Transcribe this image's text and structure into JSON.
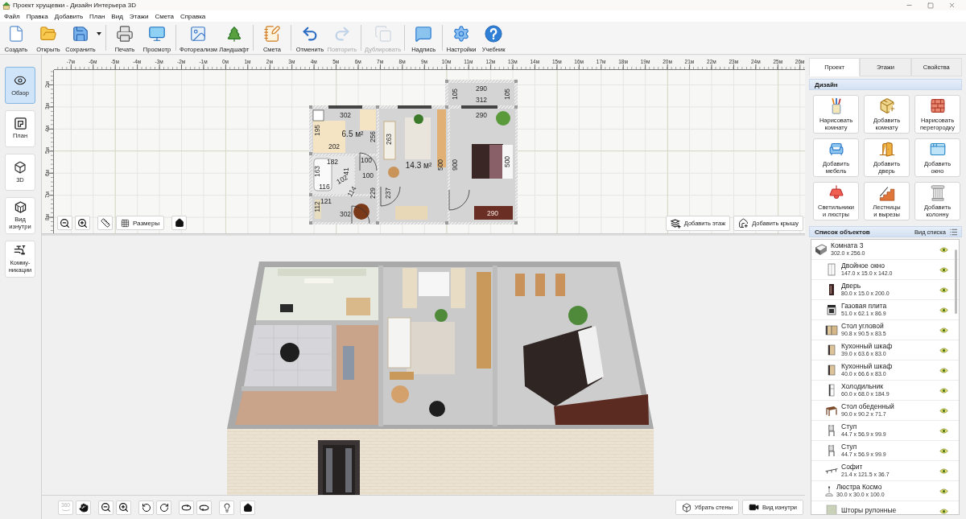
{
  "window": {
    "title": "Проект хрущевки - Дизайн Интерьера 3D"
  },
  "menu": [
    "Файл",
    "Правка",
    "Добавить",
    "План",
    "Вид",
    "Этажи",
    "Смета",
    "Справка"
  ],
  "toolbar": {
    "groups": [
      [
        {
          "label": "Создать",
          "disabled": false,
          "dropdown": false
        },
        {
          "label": "Открыть",
          "disabled": false,
          "dropdown": false
        },
        {
          "label": "Сохранить",
          "disabled": false,
          "dropdown": true
        }
      ],
      [
        {
          "label": "Печать",
          "disabled": false,
          "dropdown": false
        },
        {
          "label": "Просмотр",
          "disabled": false,
          "dropdown": false
        }
      ],
      [
        {
          "label": "Фотореализм",
          "disabled": false,
          "dropdown": false
        },
        {
          "label": "Ландшафт",
          "disabled": false,
          "dropdown": false
        }
      ],
      [
        {
          "label": "Смета",
          "disabled": false,
          "dropdown": false
        }
      ],
      [
        {
          "label": "Отменить",
          "disabled": false,
          "dropdown": false
        },
        {
          "label": "Повторить",
          "disabled": true,
          "dropdown": false
        }
      ],
      [
        {
          "label": "Дублировать",
          "disabled": true,
          "dropdown": false
        }
      ],
      [
        {
          "label": "Надпись",
          "disabled": false,
          "dropdown": false
        }
      ],
      [
        {
          "label": "Настройки",
          "disabled": false,
          "dropdown": false
        },
        {
          "label": "Учебник",
          "disabled": false,
          "dropdown": false
        }
      ]
    ]
  },
  "sidebar": {
    "items": [
      {
        "label": "Обзор",
        "selected": true
      },
      {
        "label": "План",
        "selected": false
      },
      {
        "label": "3D",
        "selected": false
      },
      {
        "label": "Вид изнутри",
        "selected": false
      },
      {
        "label": "Комму-никации",
        "selected": false
      }
    ]
  },
  "plan": {
    "ruler_x": [
      "-7м",
      "-6м",
      "-5м",
      "-4м",
      "-3м",
      "-2м",
      "-1м",
      "0м",
      "1м",
      "2м",
      "3м",
      "4м",
      "5м",
      "6м",
      "7м",
      "8м",
      "9м",
      "10м",
      "11м",
      "12м",
      "13м",
      "14м",
      "15м",
      "16м",
      "17м",
      "18м",
      "19м",
      "20м",
      "21м",
      "22м",
      "23м",
      "24м",
      "25м",
      "26м"
    ],
    "ruler_y": [
      "2м",
      "3м",
      "4м",
      "5м",
      "6м",
      "7м",
      "8м"
    ],
    "labels": [
      {
        "kind": "dimension",
        "text": "290"
      },
      {
        "kind": "dimension",
        "text": "312"
      },
      {
        "kind": "dimension",
        "text": "105"
      },
      {
        "kind": "dimension",
        "text": "105"
      },
      {
        "kind": "dimension",
        "text": "290"
      },
      {
        "kind": "dimension",
        "text": "302"
      },
      {
        "kind": "dimension",
        "text": "195"
      },
      {
        "kind": "area",
        "text": "6.5 м²"
      },
      {
        "kind": "dimension",
        "text": "202"
      },
      {
        "kind": "dimension",
        "text": "256"
      },
      {
        "kind": "dimension",
        "text": "263"
      },
      {
        "kind": "area",
        "text": "14.3 м²"
      },
      {
        "kind": "dimension",
        "text": "500"
      },
      {
        "kind": "dimension",
        "text": "900"
      },
      {
        "kind": "dimension",
        "text": "500"
      },
      {
        "kind": "dimension",
        "text": "182"
      },
      {
        "kind": "dimension",
        "text": "100"
      },
      {
        "kind": "dimension",
        "text": "163"
      },
      {
        "kind": "dimension",
        "text": "41"
      },
      {
        "kind": "dimension",
        "text": "100"
      },
      {
        "kind": "dimension",
        "text": "116"
      },
      {
        "kind": "dimension",
        "text": "102"
      },
      {
        "kind": "dimension",
        "text": "114"
      },
      {
        "kind": "dimension",
        "text": "229"
      },
      {
        "kind": "dimension",
        "text": "237"
      },
      {
        "kind": "dimension",
        "text": "121"
      },
      {
        "kind": "dimension",
        "text": "112"
      },
      {
        "kind": "dimension",
        "text": "302"
      },
      {
        "kind": "dimension",
        "text": "290"
      }
    ],
    "dimensions_button": "Размеры",
    "floor_buttons": [
      "Добавить этаж",
      "Добавить крышу"
    ]
  },
  "view_3d": {
    "rotate_button": {
      "label": "360",
      "disabled": true
    },
    "buttons": [
      "Убрать стены",
      "Вид изнутри"
    ]
  },
  "panel": {
    "tabs": [
      {
        "label": "Проект",
        "selected": true
      },
      {
        "label": "Этажи",
        "selected": false
      },
      {
        "label": "Свойства",
        "selected": false
      }
    ],
    "design": {
      "title": "Дизайн",
      "tools": [
        "Нарисовать комнату",
        "Добавить комнату",
        "Нарисовать перегородку",
        "Добавить мебель",
        "Добавить дверь",
        "Добавить окно",
        "Светильники и люстры",
        "Лестницы и вырезы",
        "Добавить колонну"
      ]
    },
    "objects": {
      "title": "Список объектов",
      "view_button": "Вид списка",
      "items": [
        {
          "kind": "room",
          "name": "Комната 3",
          "size": "302.0 x 256.0",
          "visible": true,
          "children": [
            {
              "kind": "window",
              "name": "Двойное окно",
              "size": "147.0 x 15.0 x 142.0",
              "visible": true
            },
            {
              "kind": "door",
              "name": "Дверь",
              "size": "80.0 x 15.0 x 200.0",
              "visible": true
            },
            {
              "kind": "stove",
              "name": "Газовая плита",
              "size": "51.0 x 62.1 x 86.9",
              "visible": true
            },
            {
              "kind": "corner",
              "name": "Стол угловой",
              "size": "90.8 x 90.5 x 83.5",
              "visible": true
            },
            {
              "kind": "cabinet",
              "name": "Кухонный шкаф",
              "size": "39.0 x 63.6 x 83.0",
              "visible": true
            },
            {
              "kind": "cabinet",
              "name": "Кухонный шкаф",
              "size": "40.0 x 66.6 x 83.0",
              "visible": true
            },
            {
              "kind": "fridge",
              "name": "Холодильник",
              "size": "60.0 x 68.0 x 184.9",
              "visible": true
            },
            {
              "kind": "table",
              "name": "Стол обеденный",
              "size": "90.0 x 90.2 x 71.7",
              "visible": true
            },
            {
              "kind": "chair",
              "name": "Стул",
              "size": "44.7 x 56.9 x 99.9",
              "visible": true
            },
            {
              "kind": "chair",
              "name": "Стул",
              "size": "44.7 x 56.9 x 99.9",
              "visible": true
            },
            {
              "kind": "spotlight",
              "name": "Софит",
              "size": "21.4 x 121.5 x 36.7",
              "visible": true
            },
            {
              "kind": "chandelier",
              "name": "Люстра Космо",
              "size": "30.0 x 30.0 x 100.0",
              "visible": true
            },
            {
              "kind": "blind",
              "name": "Шторы рулонные",
              "visible": true
            }
          ]
        }
      ]
    }
  }
}
